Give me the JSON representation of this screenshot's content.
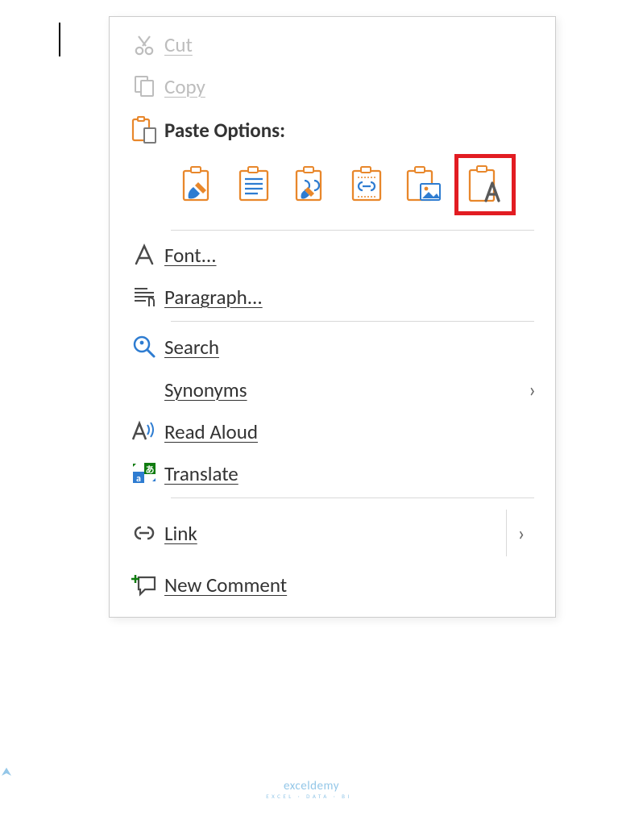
{
  "menu": {
    "cut": "Cut",
    "copy": "Copy",
    "paste_options": "Paste Options:",
    "font": "Font...",
    "paragraph": "Paragraph...",
    "search": "Search",
    "synonyms": "Synonyms",
    "read_aloud": "Read Aloud",
    "translate": "Translate",
    "link": "Link",
    "new_comment": "New Comment"
  },
  "paste_options_list": [
    "keep-source-formatting",
    "merge-formatting",
    "use-destination-theme",
    "keep-source-link",
    "picture",
    "keep-text-only"
  ],
  "watermark": {
    "brand": "exceldemy",
    "tagline": "EXCEL · DATA · BI"
  },
  "colors": {
    "accent": "#E8872B",
    "blue": "#2E7CD1",
    "green": "#107C10",
    "highlight": "#e21c22",
    "disabled": "#bdbdbd"
  }
}
